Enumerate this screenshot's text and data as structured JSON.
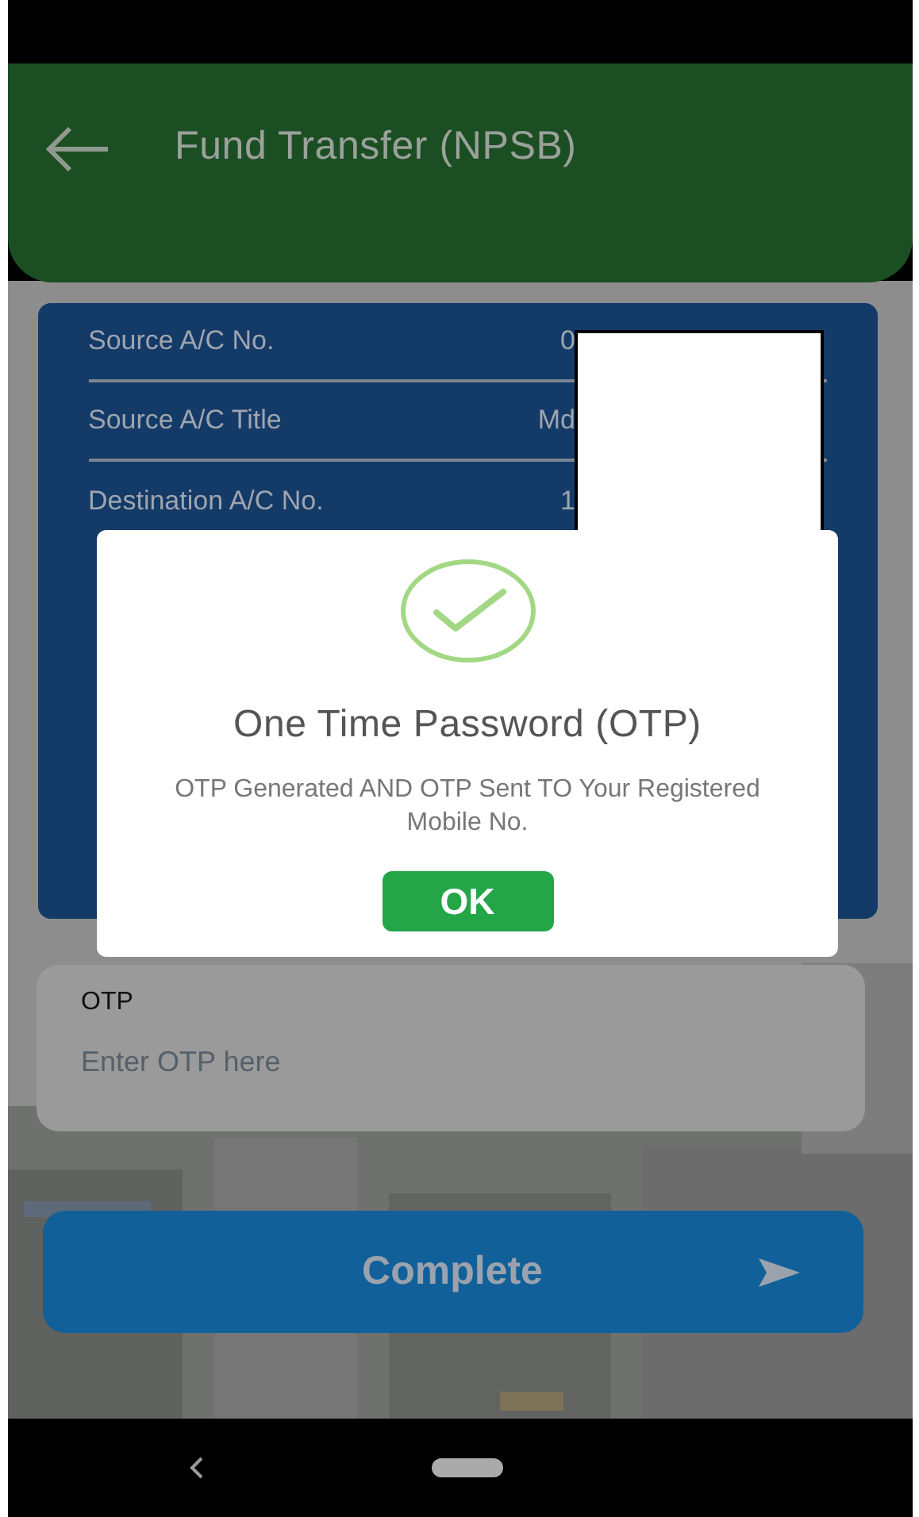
{
  "header": {
    "title": "Fund Transfer (NPSB)"
  },
  "details": [
    {
      "label": "Source A/C No.",
      "value": "0"
    },
    {
      "label": "Source A/C Title",
      "value": "Md"
    },
    {
      "label": "Destination A/C No.",
      "value": "1"
    }
  ],
  "otp_field": {
    "label": "OTP",
    "placeholder": "Enter OTP here"
  },
  "complete_button": {
    "label": "Complete"
  },
  "dialog": {
    "title": "One Time Password (OTP)",
    "message": "OTP Generated AND OTP Sent TO Your Registered Mobile No.",
    "button": "OK"
  }
}
